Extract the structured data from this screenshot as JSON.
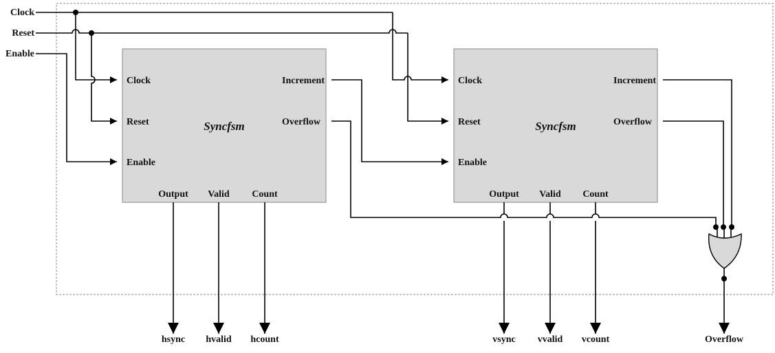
{
  "inputs": {
    "clock": "Clock",
    "reset": "Reset",
    "enable": "Enable"
  },
  "blocks": [
    {
      "name": "Syncfsm",
      "ports_in": [
        "Clock",
        "Reset",
        "Enable"
      ],
      "ports_out_right": [
        "Increment",
        "Overflow"
      ],
      "ports_out_bottom": [
        "Output",
        "Valid",
        "Count"
      ]
    },
    {
      "name": "Syncfsm",
      "ports_in": [
        "Clock",
        "Reset",
        "Enable"
      ],
      "ports_out_right": [
        "Increment",
        "Overflow"
      ],
      "ports_out_bottom": [
        "Output",
        "Valid",
        "Count"
      ]
    }
  ],
  "gate": {
    "type": "OR",
    "inputs": 3
  },
  "outputs": {
    "hsync": "hsync",
    "hvalid": "hvalid",
    "hcount": "hcount",
    "vsync": "vsync",
    "vvalid": "vvalid",
    "vcount": "vcount",
    "overflow": "Overflow"
  },
  "colors": {
    "block_fill": "#d9d9d9",
    "wire": "#000000",
    "frame": "#888888"
  }
}
